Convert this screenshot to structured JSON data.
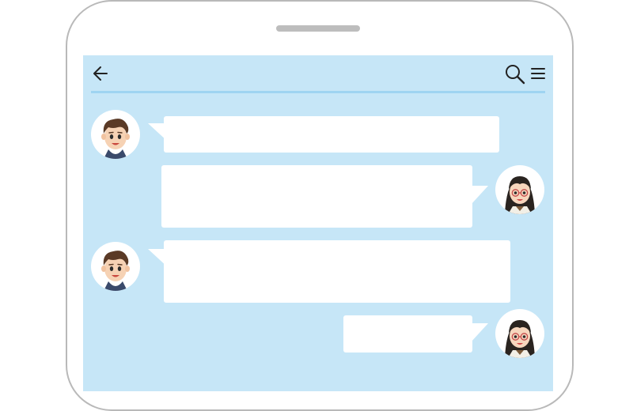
{
  "app": {
    "icons": {
      "back": "arrow-left-icon",
      "search": "search-icon",
      "menu": "hamburger-menu-icon"
    }
  },
  "messages": [
    {
      "sender": "boy",
      "side": "left",
      "text": ""
    },
    {
      "sender": "girl",
      "side": "right",
      "text": ""
    },
    {
      "sender": "boy",
      "side": "left",
      "text": ""
    },
    {
      "sender": "girl",
      "side": "right",
      "text": ""
    }
  ],
  "colors": {
    "screen_bg": "#c6e6f7",
    "divider": "#9fd4f1",
    "bubble": "#ffffff",
    "phone_frame": "#b9b9b9"
  }
}
